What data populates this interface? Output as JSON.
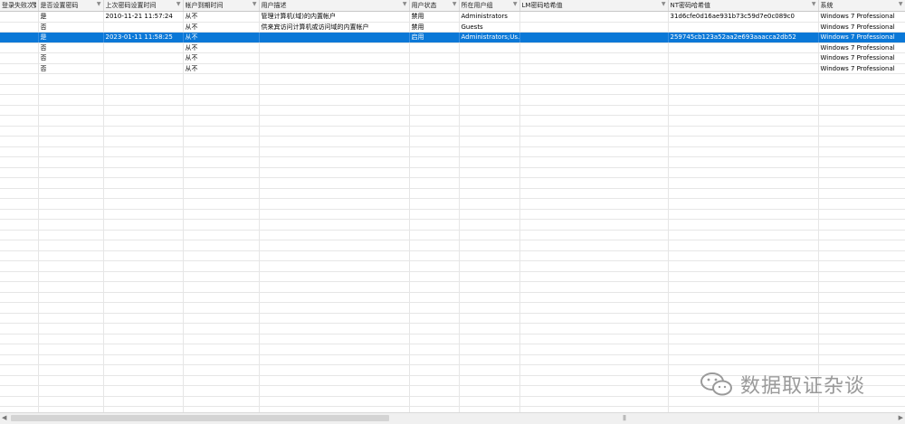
{
  "columns": [
    "登录失败次数",
    "是否设置密码",
    "上次密码设置时间",
    "帐户到期时间",
    "用户描述",
    "用户状态",
    "所在用户组",
    "LM密码哈希值",
    "NT密码哈希值",
    "系统"
  ],
  "filter_glyph": "▼",
  "rows": [
    [
      "",
      "是",
      "2010-11-21 11:57:24",
      "从不",
      "管理计算机(域)的内置帐户",
      "禁用",
      "Administrators",
      "",
      "31d6cfe0d16ae931b73c59d7e0c089c0",
      "Windows 7 Professional"
    ],
    [
      "",
      "否",
      "",
      "从不",
      "供来宾访问计算机或访问域的内置帐户",
      "禁用",
      "Guests",
      "",
      "",
      "Windows 7 Professional"
    ],
    [
      "",
      "是",
      "2023-01-11 11:58:25",
      "从不",
      "",
      "启用",
      "Administrators;Us...",
      "",
      "259745cb123a52aa2e693aaacca2db52",
      "Windows 7 Professional"
    ],
    [
      "",
      "否",
      "",
      "从不",
      "",
      "",
      "",
      "",
      "",
      "Windows 7 Professional"
    ],
    [
      "",
      "否",
      "",
      "从不",
      "",
      "",
      "",
      "",
      "",
      "Windows 7 Professional"
    ],
    [
      "",
      "否",
      "",
      "从不",
      "",
      "",
      "",
      "",
      "",
      "Windows 7 Professional"
    ]
  ],
  "selected_row_index": 2,
  "empty_row_count": 35,
  "colors": {
    "selection": "#0a78d7",
    "header_bg": "#f3f3f3",
    "watermark": "#9a9a9a"
  },
  "scrollbar": {
    "left_arrow": "◀",
    "right_arrow": "▶",
    "grip": "|||"
  },
  "watermark": {
    "icon": "wechat-icon",
    "text": "数据取证杂谈"
  }
}
